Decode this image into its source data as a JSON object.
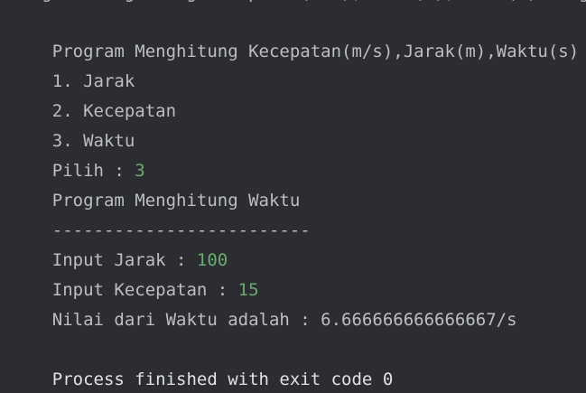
{
  "console": {
    "partial_top_line": "Program Menghitung Kecepatan(m/s),Jarak(m),Waktu(s) Program Menghitung",
    "lines": [
      {
        "prefix": "Program Menghitung Kecepatan(m/s),Jarak(m),Waktu(s)",
        "input": ""
      },
      {
        "prefix": "1. Jarak",
        "input": ""
      },
      {
        "prefix": "2. Kecepatan",
        "input": ""
      },
      {
        "prefix": "3. Waktu",
        "input": ""
      },
      {
        "prefix": "Pilih : ",
        "input": "3"
      },
      {
        "prefix": "Program Menghitung Waktu",
        "input": ""
      },
      {
        "prefix": "-------------------------",
        "input": ""
      },
      {
        "prefix": "Input Jarak : ",
        "input": "100"
      },
      {
        "prefix": "Input Kecepatan : ",
        "input": "15"
      },
      {
        "prefix": "Nilai dari Waktu adalah : 6.666666666666667/s",
        "input": ""
      },
      {
        "prefix": "",
        "input": ""
      },
      {
        "prefix": "Process finished with exit code 0",
        "input": ""
      }
    ]
  },
  "colors": {
    "background": "#2b2d30",
    "text": "#bcbec4",
    "user_input": "#6aab73"
  }
}
